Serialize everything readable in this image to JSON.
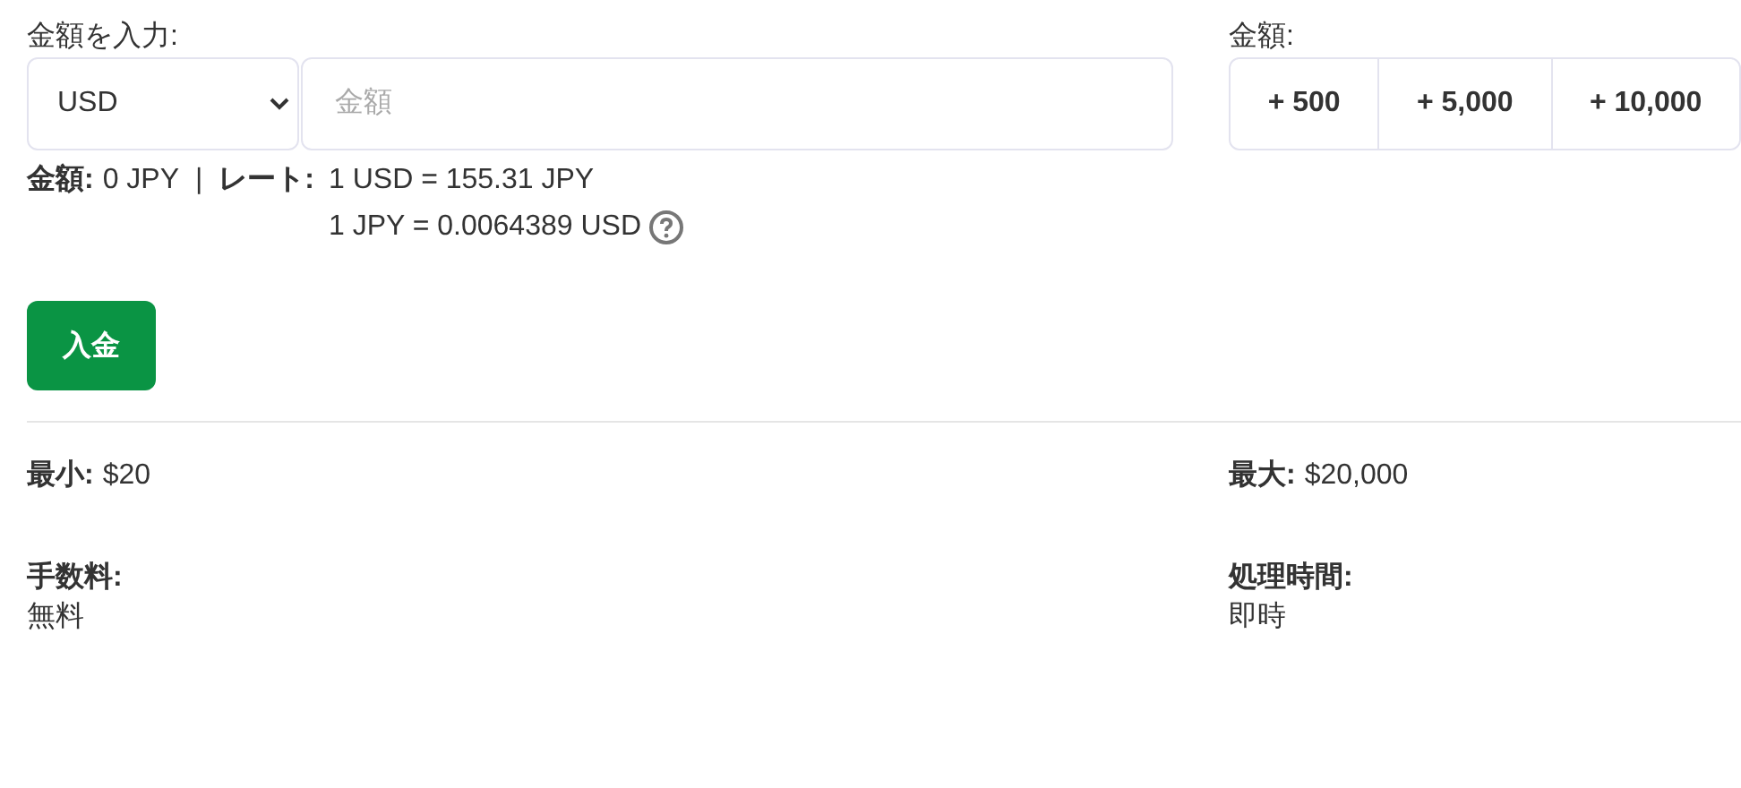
{
  "amount_input": {
    "label": "金額を入力:",
    "currency": "USD",
    "placeholder": "金額"
  },
  "summary": {
    "amount_label": "金額:",
    "amount_value": "0 JPY",
    "separator": "|",
    "rate_label": "レート:",
    "rates": [
      "1 USD = 155.31 JPY",
      "1 JPY = 0.0064389 USD"
    ]
  },
  "quick_amounts": {
    "label": "金額:",
    "buttons": [
      "+ 500",
      "+ 5,000",
      "+ 10,000"
    ]
  },
  "deposit_button": "入金",
  "info": [
    {
      "kind": "inline",
      "label": "最小:",
      "value": "$20"
    },
    {
      "kind": "inline",
      "label": "最大:",
      "value": "$20,000"
    },
    {
      "kind": "stacked",
      "label": "手数料:",
      "value": "無料"
    },
    {
      "kind": "stacked",
      "label": "処理時間:",
      "value": "即時"
    }
  ]
}
